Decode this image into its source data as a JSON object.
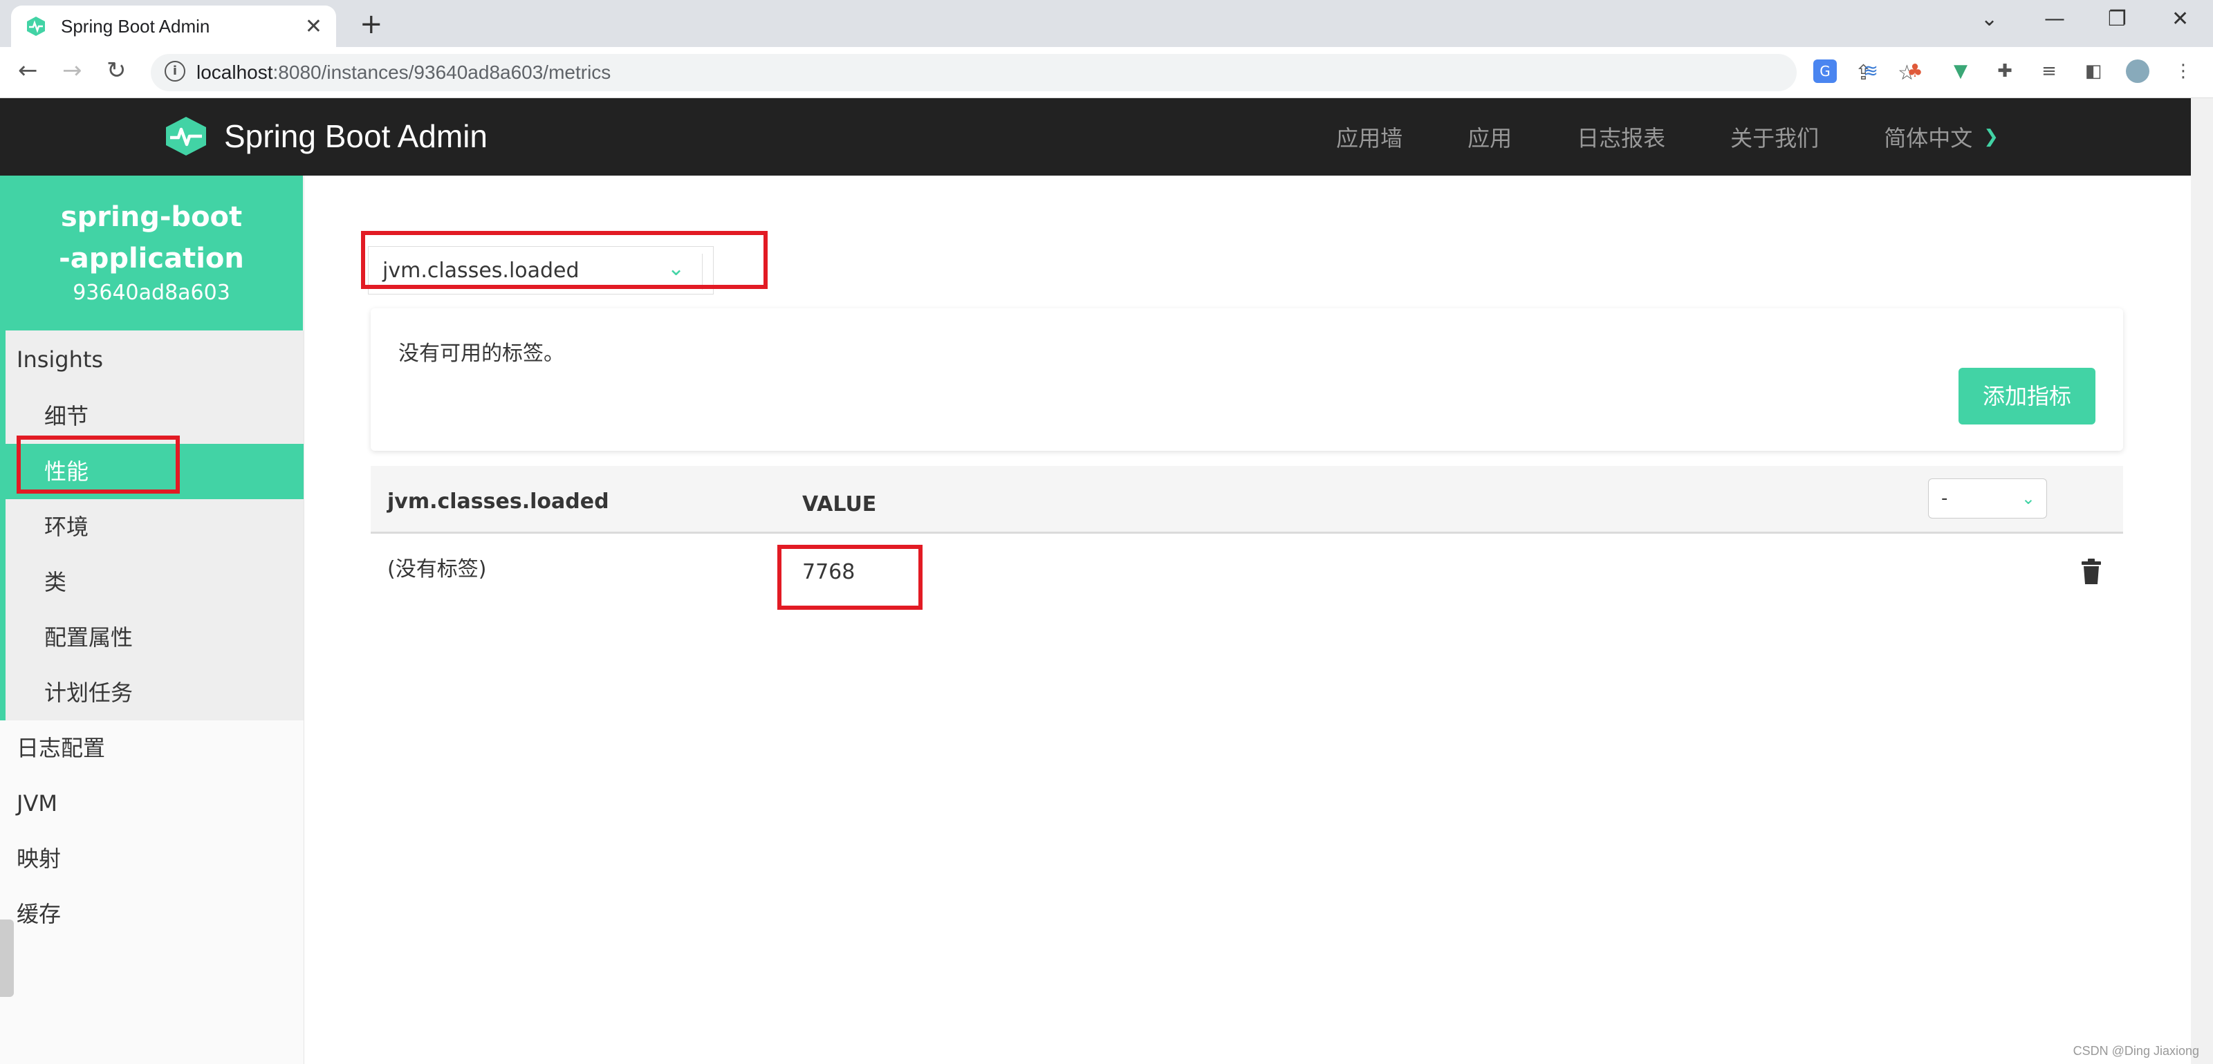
{
  "browser": {
    "tab_title": "Spring Boot Admin",
    "tab_close": "✕",
    "new_tab": "+",
    "url_host": "localhost",
    "url_rest": ":8080/instances/93640ad8a603/metrics"
  },
  "navbar": {
    "brand": "Spring Boot Admin",
    "links": [
      "应用墙",
      "应用",
      "日志报表",
      "关于我们"
    ],
    "language": "简体中文"
  },
  "sidebar": {
    "app_name": "spring-boot-application",
    "instance_id": "93640ad8a603",
    "group_title": "Insights",
    "group_items": [
      "细节",
      "性能",
      "环境",
      "类",
      "配置属性",
      "计划任务"
    ],
    "active_item": "性能",
    "top_items": [
      "日志配置",
      "JVM",
      "映射",
      "缓存"
    ]
  },
  "main": {
    "metric_select_value": "jvm.classes.loaded",
    "no_tags_message": "没有可用的标签。",
    "add_metric_button": "添加指标",
    "table": {
      "metric_name": "jvm.classes.loaded",
      "value_header": "VALUE",
      "unit_select": "-",
      "row_tag": "(没有标签)",
      "row_value": "7768"
    }
  },
  "watermark": "CSDN @Ding Jiaxiong",
  "colors": {
    "accent": "#42d3a5",
    "navbar": "#222222",
    "highlight": "#e21b24"
  },
  "icons": [
    "spring-logo-icon",
    "chevron-down-icon",
    "trash-icon",
    "info-icon",
    "star-icon",
    "share-icon"
  ]
}
